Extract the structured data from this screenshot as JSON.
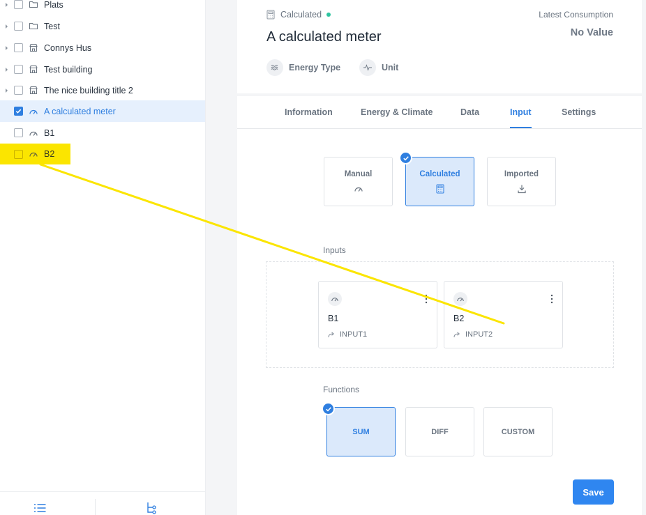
{
  "sidebar": {
    "items": [
      {
        "label": "Plats",
        "icon": "folder-icon",
        "expandable": true,
        "checked": false
      },
      {
        "label": "Test",
        "icon": "folder-icon",
        "expandable": true,
        "checked": false
      },
      {
        "label": "Connys Hus",
        "icon": "building-icon",
        "expandable": true,
        "checked": false
      },
      {
        "label": "Test building",
        "icon": "building-icon",
        "expandable": true,
        "checked": false
      },
      {
        "label": "The nice building title 2",
        "icon": "building-icon",
        "expandable": true,
        "checked": false
      },
      {
        "label": "A calculated meter",
        "icon": "meter-gauge-icon",
        "expandable": false,
        "checked": true,
        "selected": true
      },
      {
        "label": "B1",
        "icon": "meter-gauge-icon",
        "expandable": false,
        "checked": false
      },
      {
        "label": "B2",
        "icon": "meter-gauge-icon",
        "expandable": false,
        "checked": false,
        "highlighted": true
      }
    ],
    "footer": {
      "left_icon": "list-view-icon",
      "right_icon": "tree-view-icon"
    }
  },
  "header": {
    "type_label": "Calculated",
    "type_icon": "calculator-icon",
    "title": "A calculated meter",
    "latest_label": "Latest Consumption",
    "latest_value": "No Value",
    "meta": [
      {
        "label": "Energy Type",
        "icon": "energy-waves-icon"
      },
      {
        "label": "Unit",
        "icon": "pulse-icon"
      }
    ]
  },
  "tabs": [
    {
      "label": "Information",
      "active": false
    },
    {
      "label": "Energy & Climate",
      "active": false
    },
    {
      "label": "Data",
      "active": false
    },
    {
      "label": "Input",
      "active": true
    },
    {
      "label": "Settings",
      "active": false
    }
  ],
  "input_modes": [
    {
      "label": "Manual",
      "icon": "meter-gauge-icon",
      "active": false
    },
    {
      "label": "Calculated",
      "icon": "calculator-icon",
      "active": true
    },
    {
      "label": "Imported",
      "icon": "download-icon",
      "active": false
    }
  ],
  "inputs_section": {
    "label": "Inputs",
    "cards": [
      {
        "name": "B1",
        "ref": "INPUT1",
        "icon": "meter-gauge-icon"
      },
      {
        "name": "B2",
        "ref": "INPUT2",
        "icon": "meter-gauge-icon"
      }
    ]
  },
  "functions_section": {
    "label": "Functions",
    "options": [
      {
        "label": "SUM",
        "active": true
      },
      {
        "label": "DIFF",
        "active": false
      },
      {
        "label": "CUSTOM",
        "active": false
      }
    ]
  },
  "save_label": "Save",
  "colors": {
    "accent": "#2f7fe0",
    "status_dot": "#2ec4a0",
    "annotation_highlight": "#fbe500"
  }
}
